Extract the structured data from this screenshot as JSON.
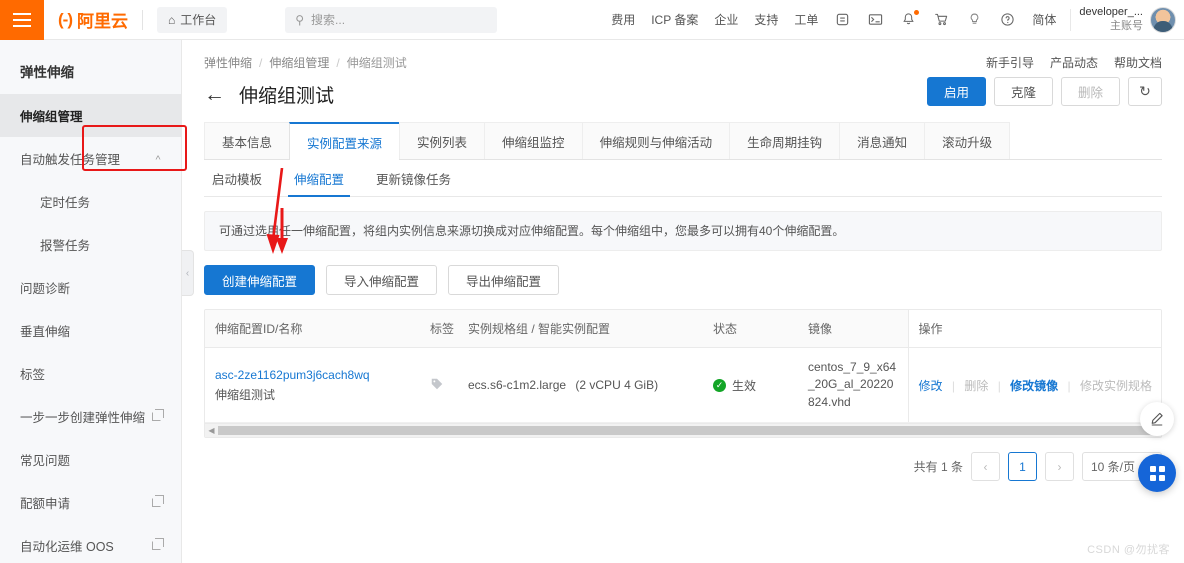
{
  "topbar": {
    "menu_icon": "hamburger-icon",
    "brand_logo": "(-)",
    "brand_text": "阿里云",
    "workbench_label": "工作台",
    "workbench_icon": "home-icon",
    "search_placeholder": "搜索...",
    "search_icon": "search-icon",
    "links": [
      {
        "label": "费用"
      },
      {
        "label": "ICP 备案"
      },
      {
        "label": "企业"
      },
      {
        "label": "支持"
      },
      {
        "label": "工单"
      }
    ],
    "icons": [
      {
        "name": "app-store-icon",
        "glyph": "⌷"
      },
      {
        "name": "terminal-icon",
        "glyph": "▣"
      },
      {
        "name": "bell-icon",
        "glyph": "♩",
        "badge": true
      },
      {
        "name": "cart-icon",
        "glyph": "⛟"
      },
      {
        "name": "bulb-icon",
        "glyph": "○"
      },
      {
        "name": "help-icon",
        "glyph": "?"
      }
    ],
    "language": "简体",
    "user_name": "developer_...",
    "user_sub": "主账号"
  },
  "sidebar": {
    "title": "弹性伸缩",
    "items": [
      {
        "label": "伸缩组管理",
        "active": true,
        "sub": false,
        "external": false,
        "chevron": ""
      },
      {
        "label": "自动触发任务管理",
        "active": false,
        "sub": false,
        "external": false,
        "chevron": "˄"
      },
      {
        "label": "定时任务",
        "active": false,
        "sub": true,
        "external": false,
        "chevron": ""
      },
      {
        "label": "报警任务",
        "active": false,
        "sub": true,
        "external": false,
        "chevron": ""
      },
      {
        "label": "问题诊断",
        "active": false,
        "sub": false,
        "external": false,
        "chevron": ""
      },
      {
        "label": "垂直伸缩",
        "active": false,
        "sub": false,
        "external": false,
        "chevron": ""
      },
      {
        "label": "标签",
        "active": false,
        "sub": false,
        "external": false,
        "chevron": ""
      },
      {
        "label": "一步一步创建弹性伸缩",
        "active": false,
        "sub": false,
        "external": true,
        "chevron": ""
      },
      {
        "label": "常见问题",
        "active": false,
        "sub": false,
        "external": false,
        "chevron": ""
      },
      {
        "label": "配额申请",
        "active": false,
        "sub": false,
        "external": true,
        "chevron": ""
      },
      {
        "label": "自动化运维 OOS",
        "active": false,
        "sub": false,
        "external": true,
        "chevron": ""
      }
    ],
    "collapse_icon": "‹"
  },
  "breadcrumb": {
    "items": [
      "弹性伸缩",
      "伸缩组管理",
      "伸缩组测试"
    ],
    "separator": "/"
  },
  "header": {
    "back_icon": "←",
    "title": "伸缩组测试",
    "help_links": [
      "新手引导",
      "产品动态",
      "帮助文档"
    ],
    "actions": [
      {
        "label": "启用",
        "style": "primary"
      },
      {
        "label": "克隆",
        "style": "default"
      },
      {
        "label": "删除",
        "style": "disabled"
      }
    ],
    "refresh_icon": "↻"
  },
  "tabs": [
    {
      "label": "基本信息",
      "active": false
    },
    {
      "label": "实例配置来源",
      "active": true
    },
    {
      "label": "实例列表",
      "active": false
    },
    {
      "label": "伸缩组监控",
      "active": false
    },
    {
      "label": "伸缩规则与伸缩活动",
      "active": false
    },
    {
      "label": "生命周期挂钩",
      "active": false
    },
    {
      "label": "消息通知",
      "active": false
    },
    {
      "label": "滚动升级",
      "active": false
    }
  ],
  "subtabs": [
    {
      "label": "启动模板",
      "active": false
    },
    {
      "label": "伸缩配置",
      "active": true
    },
    {
      "label": "更新镜像任务",
      "active": false
    }
  ],
  "banner": {
    "text": "可通过选用任一伸缩配置，将组内实例信息来源切换成对应伸缩配置。每个伸缩组中，您最多可以拥有40个伸缩配置。"
  },
  "toolbar": {
    "buttons": [
      {
        "label": "创建伸缩配置",
        "style": "primary"
      },
      {
        "label": "导入伸缩配置",
        "style": "default"
      },
      {
        "label": "导出伸缩配置",
        "style": "default"
      }
    ]
  },
  "table": {
    "columns": [
      "伸缩配置ID/名称",
      "标签",
      "实例规格组 / 智能实例配置",
      "状态",
      "镜像",
      "操作"
    ],
    "rows": [
      {
        "config_id": "asc-2ze1162pum3j6cach8wq",
        "config_name": "伸缩组测试",
        "tag_icon": "tag-icon",
        "instance_type": "ecs.s6-c1m2.large",
        "instance_spec": "(2 vCPU 4 GiB)",
        "status": "生效",
        "status_icon": "check-circle-icon",
        "image": "centos_7_9_x64_20G_al_20220824.vhd",
        "operations": [
          {
            "label": "修改",
            "disabled": false,
            "strong": false
          },
          {
            "label": "删除",
            "disabled": true,
            "strong": false
          },
          {
            "label": "修改镜像",
            "disabled": false,
            "strong": true
          },
          {
            "label": "修改实例规格",
            "disabled": true,
            "strong": false
          }
        ]
      }
    ],
    "scroll_left_icon": "◀"
  },
  "pagination": {
    "total_text": "共有 1 条",
    "prev_icon": "‹",
    "current_page": "1",
    "next_icon": "›",
    "page_size": "10 条/页",
    "caret_icon": "⌄"
  },
  "floating": {
    "pencil_icon": "pencil-icon",
    "grid_icon": "grid-icon"
  },
  "watermark": "CSDN @勿扰客",
  "colors": {
    "brand_orange": "#ff6a00",
    "primary_blue": "#1677d2",
    "annotation_red": "#e81818",
    "status_green": "#13a527"
  }
}
